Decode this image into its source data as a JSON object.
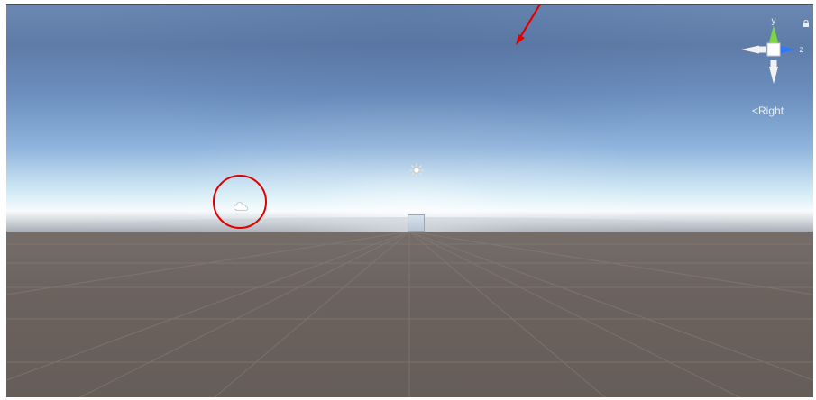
{
  "scene_view": {
    "orientation_gizmo": {
      "axis_y_label": "y",
      "axis_z_label": "z",
      "view_label": "Right",
      "view_label_icon": "perspective-chevron-icon",
      "lock_icon": "lock-icon",
      "colors": {
        "y_axis": "#7dd53f",
        "z_axis": "#2e78ff",
        "neutral_axis": "#e8e8e8"
      }
    },
    "objects": [
      {
        "name": "directional-light",
        "icon": "sun-icon"
      },
      {
        "name": "cube",
        "icon": "cube"
      },
      {
        "name": "cloud-gizmo",
        "icon": "cloud-icon"
      }
    ],
    "annotations": {
      "highlight_circle_color": "#e00000",
      "arrow_color": "#e00000"
    },
    "colors": {
      "sky_top": "#5f7ba8",
      "horizon": "#f7fbfd",
      "ground": "#6b625e"
    }
  }
}
